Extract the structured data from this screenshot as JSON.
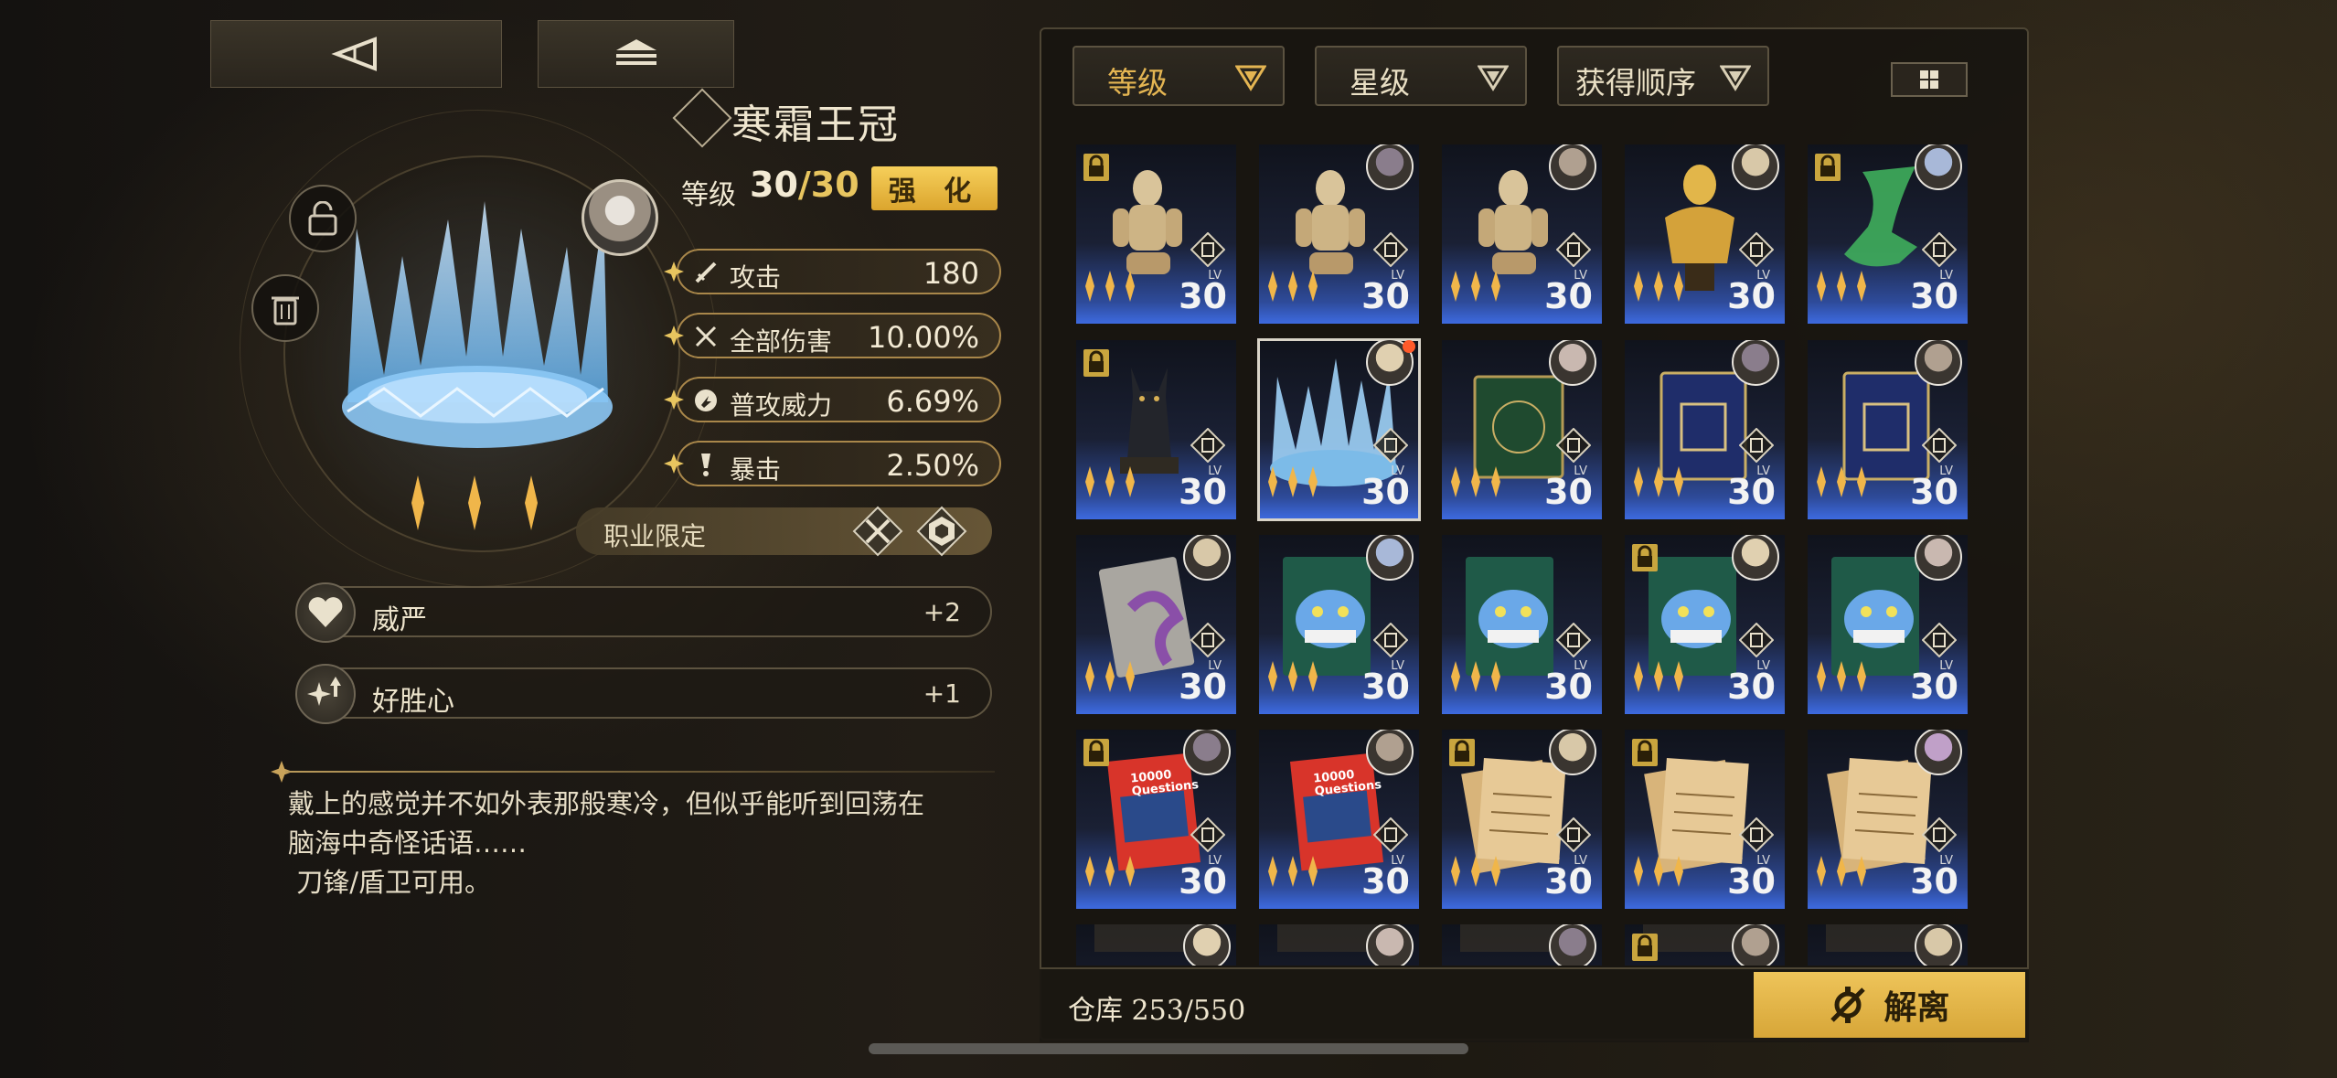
{
  "item": {
    "name": "寒霜王冠",
    "level_label": "等级",
    "level_current": "30",
    "level_sep": "/",
    "level_max": "30",
    "enhance_label": "强 化",
    "rarity_stars": 3
  },
  "stats": [
    {
      "name": "攻击",
      "value": "180",
      "icon": "sword-icon"
    },
    {
      "name": "全部伤害",
      "value": "10.00%",
      "icon": "crossed-swords-icon"
    },
    {
      "name": "普攻威力",
      "value": "6.69%",
      "icon": "fist-icon"
    },
    {
      "name": "暴击",
      "value": "2.50%",
      "icon": "exclamation-icon"
    }
  ],
  "job_limit": {
    "label": "职业限定",
    "icons": [
      "blade-class-icon",
      "shield-class-icon"
    ]
  },
  "skills": [
    {
      "name": "威严",
      "value": "+2",
      "icon": "heart-icon"
    },
    {
      "name": "好胜心",
      "value": "+1",
      "icon": "sparkle-up-icon"
    }
  ],
  "description": {
    "lines": [
      "戴上的感觉并不如外表那般寒冷，但似乎能听到回荡在",
      "脑海中奇怪话语……",
      " 刀锋/盾卫可用。"
    ]
  },
  "filters": {
    "level": "等级",
    "star": "星级",
    "order": "获得顺序"
  },
  "cards": [
    {
      "item": "wooden-doll",
      "lock": true,
      "avatar": false,
      "level": "30",
      "stars": 3,
      "selected": false
    },
    {
      "item": "wooden-doll",
      "lock": false,
      "avatar": true,
      "level": "30",
      "stars": 3,
      "selected": false
    },
    {
      "item": "wooden-doll",
      "lock": false,
      "avatar": true,
      "level": "30",
      "stars": 3,
      "selected": false
    },
    {
      "item": "gold-bust",
      "lock": false,
      "avatar": true,
      "level": "30",
      "stars": 3,
      "selected": false
    },
    {
      "item": "jade-dancer",
      "lock": true,
      "avatar": true,
      "level": "30",
      "stars": 3,
      "selected": false
    },
    {
      "item": "black-cat",
      "lock": true,
      "avatar": false,
      "level": "30",
      "stars": 3,
      "selected": false
    },
    {
      "item": "ice-crown",
      "lock": false,
      "avatar": true,
      "level": "30",
      "stars": 3,
      "selected": true
    },
    {
      "item": "green-book",
      "lock": false,
      "avatar": true,
      "level": "30",
      "stars": 3,
      "selected": false
    },
    {
      "item": "blue-book",
      "lock": false,
      "avatar": true,
      "level": "30",
      "stars": 3,
      "selected": false
    },
    {
      "item": "blue-book",
      "lock": false,
      "avatar": true,
      "level": "30",
      "stars": 3,
      "selected": false
    },
    {
      "item": "tentacle-card",
      "lock": false,
      "avatar": true,
      "level": "30",
      "stars": 3,
      "selected": false
    },
    {
      "item": "cheshire-card",
      "lock": false,
      "avatar": true,
      "level": "30",
      "stars": 3,
      "selected": false
    },
    {
      "item": "cheshire-card",
      "lock": false,
      "avatar": false,
      "level": "30",
      "stars": 3,
      "selected": false
    },
    {
      "item": "cheshire-card",
      "lock": true,
      "avatar": true,
      "level": "30",
      "stars": 3,
      "selected": false
    },
    {
      "item": "cheshire-card",
      "lock": false,
      "avatar": true,
      "level": "30",
      "stars": 3,
      "selected": false
    },
    {
      "item": "question-book",
      "lock": true,
      "avatar": true,
      "level": "30",
      "stars": 3,
      "selected": false
    },
    {
      "item": "question-book",
      "lock": false,
      "avatar": true,
      "level": "30",
      "stars": 3,
      "selected": false
    },
    {
      "item": "music-sheet",
      "lock": true,
      "avatar": true,
      "level": "30",
      "stars": 3,
      "selected": false
    },
    {
      "item": "music-sheet",
      "lock": true,
      "avatar": false,
      "level": "30",
      "stars": 3,
      "selected": false
    },
    {
      "item": "music-sheet",
      "lock": false,
      "avatar": true,
      "level": "30",
      "stars": 3,
      "selected": false
    },
    {
      "item": "unknown",
      "lock": false,
      "avatar": true,
      "level": "",
      "stars": 0,
      "selected": false
    },
    {
      "item": "unknown",
      "lock": false,
      "avatar": true,
      "level": "",
      "stars": 0,
      "selected": false
    },
    {
      "item": "unknown",
      "lock": false,
      "avatar": true,
      "level": "",
      "stars": 0,
      "selected": false
    },
    {
      "item": "unknown",
      "lock": true,
      "avatar": true,
      "level": "",
      "stars": 0,
      "selected": false
    },
    {
      "item": "unknown",
      "lock": false,
      "avatar": true,
      "level": "",
      "stars": 0,
      "selected": false
    }
  ],
  "card_lv_label": "LV",
  "card_text": {
    "question_book": "10000 Questions"
  },
  "footer": {
    "storage_label": "仓库",
    "storage_value": "253/550",
    "dismantle_label": "解离"
  },
  "colors": {
    "gold": "#e8c55f",
    "accent_button": "#e2b447",
    "card_blue": "#3d6ae0",
    "notify_dot": "#ff5a2a"
  }
}
